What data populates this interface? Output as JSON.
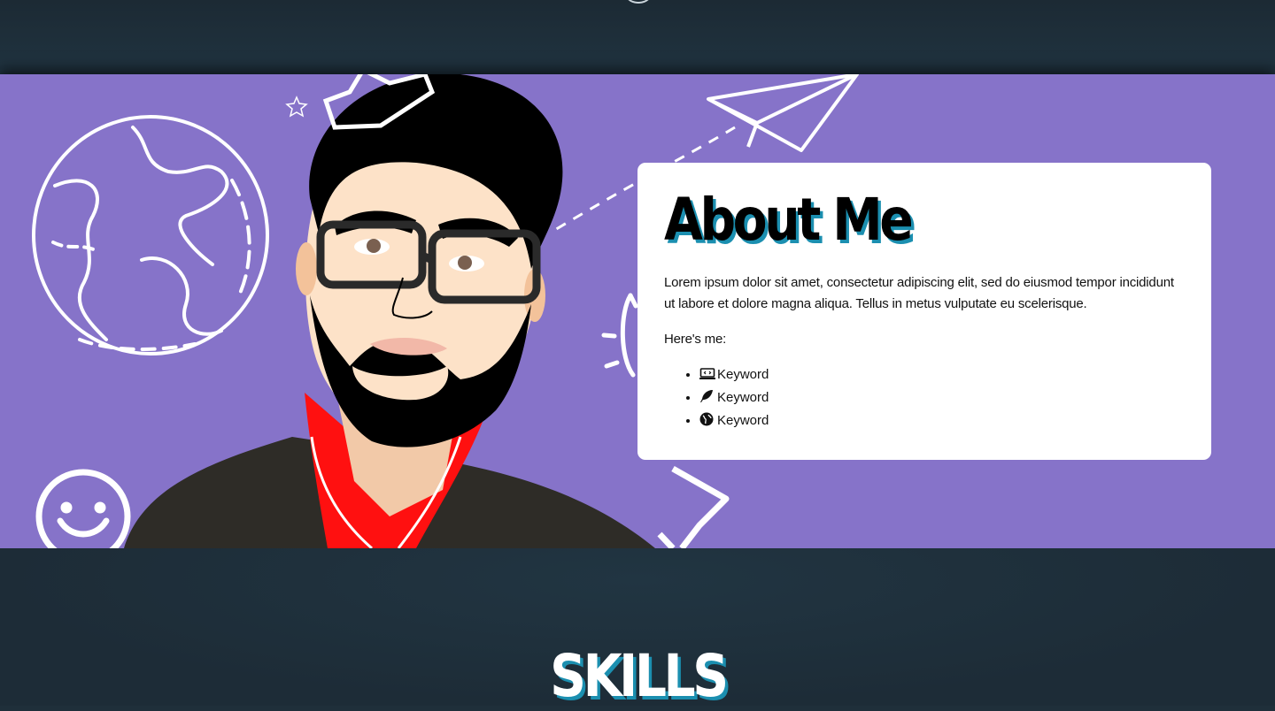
{
  "about": {
    "title": "About Me",
    "intro": "Lorem ipsum dolor sit amet, consectetur adipiscing elit, sed do eiusmod tempor incididunt ut labore et dolore magna aliqua. Tellus in metus vulputate eu scelerisque.",
    "here_label": "Here's me:",
    "keywords": [
      {
        "icon": "laptop-code-icon",
        "label": "Keyword"
      },
      {
        "icon": "feather-icon",
        "label": "Keyword"
      },
      {
        "icon": "globe-icon",
        "label": "Keyword"
      }
    ]
  },
  "skills": {
    "title": "SKILLS"
  },
  "colors": {
    "hero_background": "#8673c9",
    "page_background": "#1f2f3a",
    "heading_shadow": "#1b8fb0",
    "card_background": "#ffffff"
  }
}
